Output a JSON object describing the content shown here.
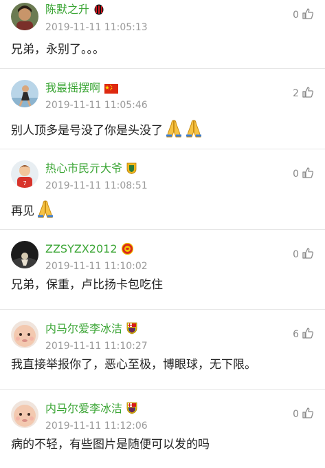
{
  "comments": [
    {
      "username": "陈默之升",
      "time": "2019-11-11 11:05:13",
      "likes": "0",
      "text": "兄弟，永别了。。。",
      "badge_icon": "ac-milan-badge-icon",
      "avatar_icon": "avatar-photo"
    },
    {
      "username": "我最摇摆啊",
      "time": "2019-11-11 11:05:46",
      "likes": "2",
      "text": "别人顶多是号没了你是头没了",
      "badge_icon": "china-flag-icon",
      "avatar_icon": "avatar-photo",
      "emoji": [
        "praying-hands-icon",
        "praying-hands-icon"
      ]
    },
    {
      "username": "热心市民亓大爷",
      "time": "2019-11-11 11:08:51",
      "likes": "0",
      "text": "再见",
      "badge_icon": "club-crest-icon",
      "avatar_icon": "avatar-cartoon",
      "emoji": [
        "praying-hands-icon"
      ]
    },
    {
      "username": "ZZSYZX2012",
      "time": "2019-11-11 11:10:02",
      "likes": "0",
      "text": "兄弟，保重，卢比扬卡包吃住",
      "badge_icon": "manchester-united-badge-icon",
      "avatar_icon": "avatar-photo"
    },
    {
      "username": "内马尔爱李冰洁",
      "time": "2019-11-11 11:10:27",
      "likes": "6",
      "text": "我直接举报你了，恶心至极，博眼球，无下限。",
      "badge_icon": "barcelona-badge-icon",
      "avatar_icon": "avatar-baby-face"
    },
    {
      "username": "内马尔爱李冰洁",
      "time": "2019-11-11 11:12:06",
      "likes": "0",
      "text": "病的不轻，有些图片是随便可以发的吗",
      "badge_icon": "barcelona-badge-icon",
      "avatar_icon": "avatar-baby-face"
    }
  ],
  "colors": {
    "username": "#3aa534",
    "timestamp": "#9a9a9a",
    "divider": "#e6e6e6",
    "like_icon": "#888888"
  }
}
